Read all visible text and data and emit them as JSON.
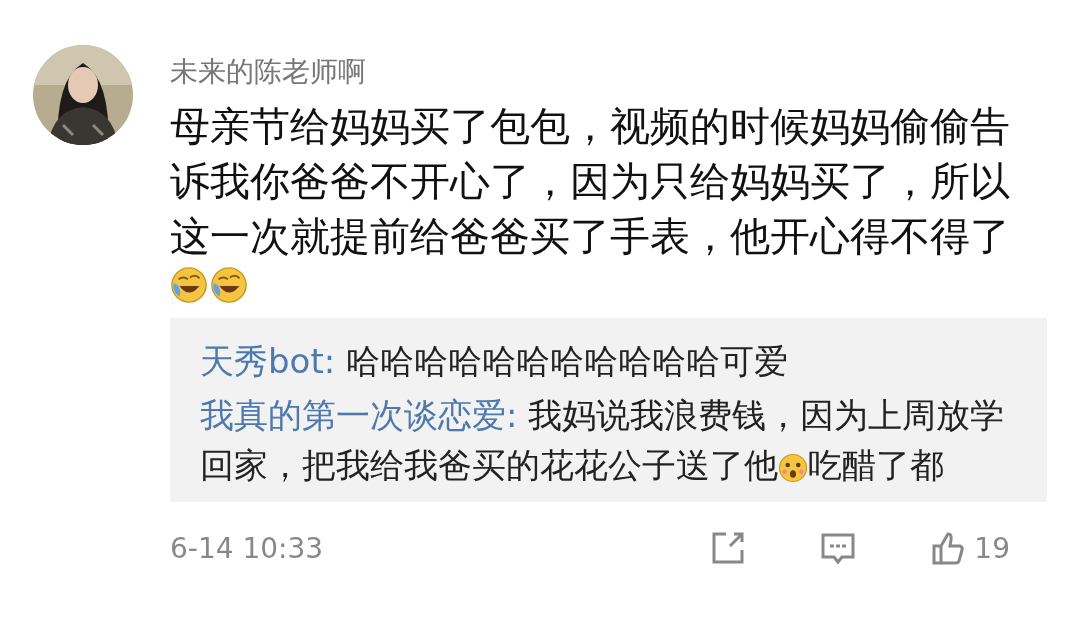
{
  "comment": {
    "author": "未来的陈老师啊",
    "text": "母亲节给妈妈买了包包，视频的时候妈妈偷偷告诉我你爸爸不开心了，因为只给妈妈买了，所以这一次就提前给爸爸买了手表，他开心得不得了",
    "trailing_emoji": [
      {
        "kind": "laugh-cry"
      },
      {
        "kind": "laugh-cry"
      }
    ]
  },
  "replies": [
    {
      "user": "天秀bot:",
      "segments": [
        {
          "kind": "text",
          "text": "哈哈哈哈哈哈哈哈哈哈哈可爱"
        }
      ]
    },
    {
      "user": "我真的第一次谈恋爱:",
      "segments": [
        {
          "kind": "text",
          "text": "我妈说我浪费钱，因为上周放学回家，把我给我爸买的花花公子送了他"
        },
        {
          "kind": "shock-emoji"
        },
        {
          "kind": "text",
          "text": "吃醋了都"
        }
      ]
    }
  ],
  "footer": {
    "time": "6-14 10:33",
    "like_count": "19"
  }
}
